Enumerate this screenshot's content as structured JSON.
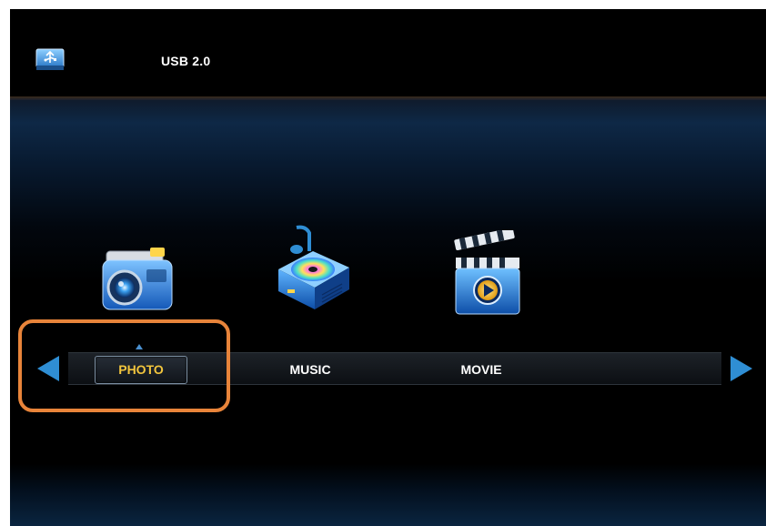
{
  "header": {
    "source_label": "USB 2.0",
    "source_icon": "usb-drive-icon"
  },
  "menu": {
    "items": [
      {
        "label": "PHOTO",
        "icon": "camera-icon",
        "selected": true
      },
      {
        "label": "MUSIC",
        "icon": "music-player-icon",
        "selected": false
      },
      {
        "label": "MOVIE",
        "icon": "clapperboard-icon",
        "selected": false
      }
    ],
    "nav_prev": "left-arrow-icon",
    "nav_next": "right-arrow-icon"
  },
  "colors": {
    "accent_blue": "#2f8ed4",
    "selected_text": "#f2c53d",
    "highlight_frame": "#e8843a",
    "text": "#ffffff"
  }
}
